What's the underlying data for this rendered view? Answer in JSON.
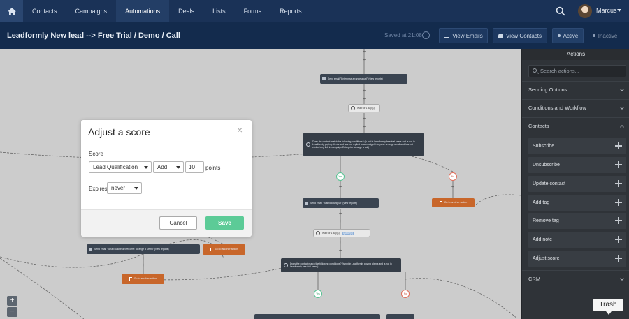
{
  "nav": {
    "items": [
      {
        "label": "Contacts"
      },
      {
        "label": "Campaigns"
      },
      {
        "label": "Automations",
        "active": true
      },
      {
        "label": "Deals"
      },
      {
        "label": "Lists"
      },
      {
        "label": "Forms"
      },
      {
        "label": "Reports"
      }
    ],
    "user_name": "Marcus",
    "home_icon": "home-icon",
    "search_icon": "search-icon"
  },
  "titlebar": {
    "title": "Leadformly New lead --> Free Trial / Demo / Call",
    "saved": "Saved at 21:08",
    "view_emails": "View Emails",
    "view_contacts": "View Contacts",
    "active": "Active",
    "inactive": "Inactive"
  },
  "canvas": {
    "nodes": {
      "email1": "Send email \"Enterprise arrange a call\" (view reports)",
      "wait1": "Wait for 1 day(s)",
      "cond1": "Does the contact match the following conditions? (is not in Leadformly free trial users and is not in Leadformly paying clients and has not replied to campaign Enterprise arrange a call and has not clicked any link in campaign Enterprise arrange a call)",
      "yes": "Yes",
      "no": "No",
      "email2": "Send email \"Just following up\" (view reports)",
      "goto_right": "Go to another action",
      "wait2": "Wait for 1 day(s)",
      "wait2_tag": "Queue(1)",
      "email3": "Send email \"Small Business Welcome: Arrange a Demo\" (view reports)",
      "goto_mid": "Go to another action",
      "cond2": "Does the contact match the following conditions? (is not in Leadformly paying clients and is not in Leadformly free trial users)",
      "goto_left": "Go to another action",
      "yes2": "Yes",
      "no2": "No"
    },
    "zoom_in": "+",
    "zoom_out": "−"
  },
  "modal": {
    "title": "Adjust a score",
    "close": "×",
    "score_label": "Score",
    "score_value": "Lead Qualification",
    "operation": "Add",
    "points_value": "10",
    "points_label": "points",
    "expires_label": "Expires",
    "expires_value": "never",
    "cancel": "Cancel",
    "save": "Save"
  },
  "panel": {
    "title": "Actions",
    "search_placeholder": "Search actions...",
    "sections": {
      "sending": "Sending Options",
      "conditions": "Conditions and Workflow",
      "contacts": "Contacts",
      "crm": "CRM"
    },
    "contact_items": [
      "Subscribe",
      "Unsubscribe",
      "Update contact",
      "Add tag",
      "Remove tag",
      "Add note",
      "Adjust score"
    ],
    "trash": "Trash"
  },
  "colors": {
    "nav_bg": "#1a3257",
    "title_bg": "#132b4d",
    "panel_bg": "#2f3338",
    "canvas_bg": "#cccccc",
    "save_green": "#5ccb97",
    "goto_orange": "#c8662a"
  }
}
